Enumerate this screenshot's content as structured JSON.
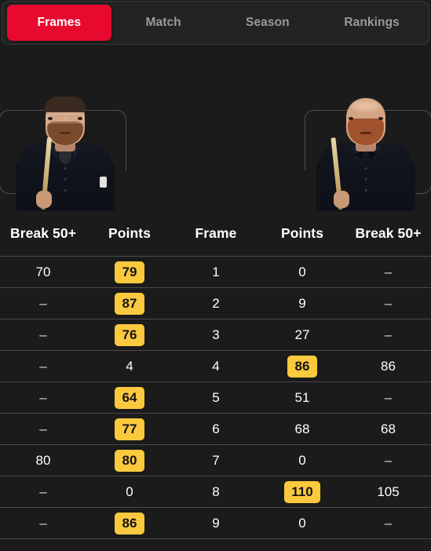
{
  "theme": {
    "background": "#1b1b1b",
    "tabbar_bg": "#232323",
    "tabbar_border": "#3a3a3a",
    "active_tab_bg": "#e8092e",
    "active_tab_text": "#ffffff",
    "inactive_tab_text": "#9a9a9a",
    "text": "#ffffff",
    "divider": "#4a4a4a",
    "highlight_bg": "#fbc93d",
    "highlight_text": "#141414"
  },
  "tabs": [
    {
      "label": "Frames",
      "active": true,
      "name": "tab-frames"
    },
    {
      "label": "Match",
      "active": false,
      "name": "tab-match"
    },
    {
      "label": "Season",
      "active": false,
      "name": "tab-season"
    },
    {
      "label": "Rankings",
      "active": false,
      "name": "tab-rankings"
    }
  ],
  "players": {
    "left": {
      "icon": "player-photo-left",
      "description": "snooker player portrait holding cue"
    },
    "right": {
      "icon": "player-photo-right",
      "description": "snooker player portrait holding cue"
    }
  },
  "table": {
    "headers": [
      "Break 50+",
      "Points",
      "Frame",
      "Points",
      "Break 50+"
    ],
    "rows": [
      {
        "left_break": "70",
        "left_points": "79",
        "left_win": true,
        "frame": "1",
        "right_points": "0",
        "right_win": false,
        "right_break": "–"
      },
      {
        "left_break": "–",
        "left_points": "87",
        "left_win": true,
        "frame": "2",
        "right_points": "9",
        "right_win": false,
        "right_break": "–"
      },
      {
        "left_break": "–",
        "left_points": "76",
        "left_win": true,
        "frame": "3",
        "right_points": "27",
        "right_win": false,
        "right_break": "–"
      },
      {
        "left_break": "–",
        "left_points": "4",
        "left_win": false,
        "frame": "4",
        "right_points": "86",
        "right_win": true,
        "right_break": "86"
      },
      {
        "left_break": "–",
        "left_points": "64",
        "left_win": true,
        "frame": "5",
        "right_points": "51",
        "right_win": false,
        "right_break": "–"
      },
      {
        "left_break": "–",
        "left_points": "77",
        "left_win": true,
        "frame": "6",
        "right_points": "68",
        "right_win": false,
        "right_break": "68"
      },
      {
        "left_break": "80",
        "left_points": "80",
        "left_win": true,
        "frame": "7",
        "right_points": "0",
        "right_win": false,
        "right_break": "–"
      },
      {
        "left_break": "–",
        "left_points": "0",
        "left_win": false,
        "frame": "8",
        "right_points": "110",
        "right_win": true,
        "right_break": "105"
      },
      {
        "left_break": "–",
        "left_points": "86",
        "left_win": true,
        "frame": "9",
        "right_points": "0",
        "right_win": false,
        "right_break": "–"
      }
    ]
  }
}
